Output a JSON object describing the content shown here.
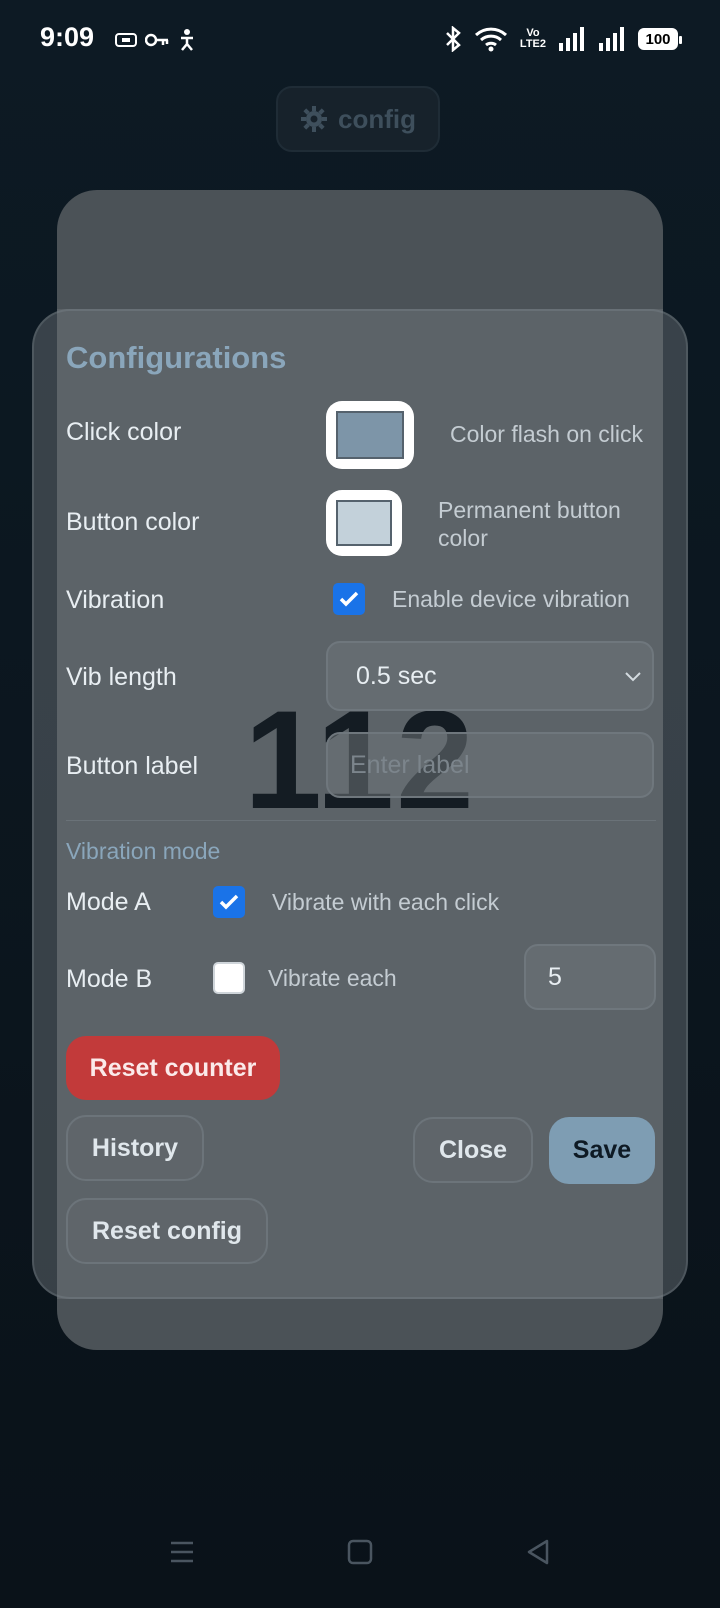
{
  "status_bar": {
    "time": "9:09",
    "battery": "100",
    "volte_top": "Vo",
    "volte_bottom": "LTE2"
  },
  "top_button": {
    "label": "config"
  },
  "counter": {
    "value": "112"
  },
  "dialog": {
    "title": "Configurations",
    "click_color": {
      "label": "Click color",
      "hint": "Color flash on click",
      "value": "#7d95a8"
    },
    "button_color": {
      "label": "Button color",
      "hint": "Permanent button color",
      "value": "#c3d1da"
    },
    "vibration": {
      "label": "Vibration",
      "hint": "Enable device vibration",
      "checked": true
    },
    "vib_length": {
      "label": "Vib length",
      "value": "0.5 sec"
    },
    "button_label": {
      "label": "Button label",
      "placeholder": "Enter label"
    },
    "vibration_mode": {
      "section_label": "Vibration mode",
      "mode_a": {
        "label": "Mode A",
        "hint": "Vibrate with each click",
        "checked": true
      },
      "mode_b": {
        "label": "Mode B",
        "hint": "Vibrate each",
        "checked": false,
        "value": "5"
      }
    },
    "buttons": {
      "reset_counter": "Reset counter",
      "history": "History",
      "close": "Close",
      "save": "Save",
      "reset_config": "Reset config"
    }
  },
  "colors": {
    "accent": "#1a73e8",
    "danger": "#c23a3a",
    "primary": "#7e9db3"
  }
}
